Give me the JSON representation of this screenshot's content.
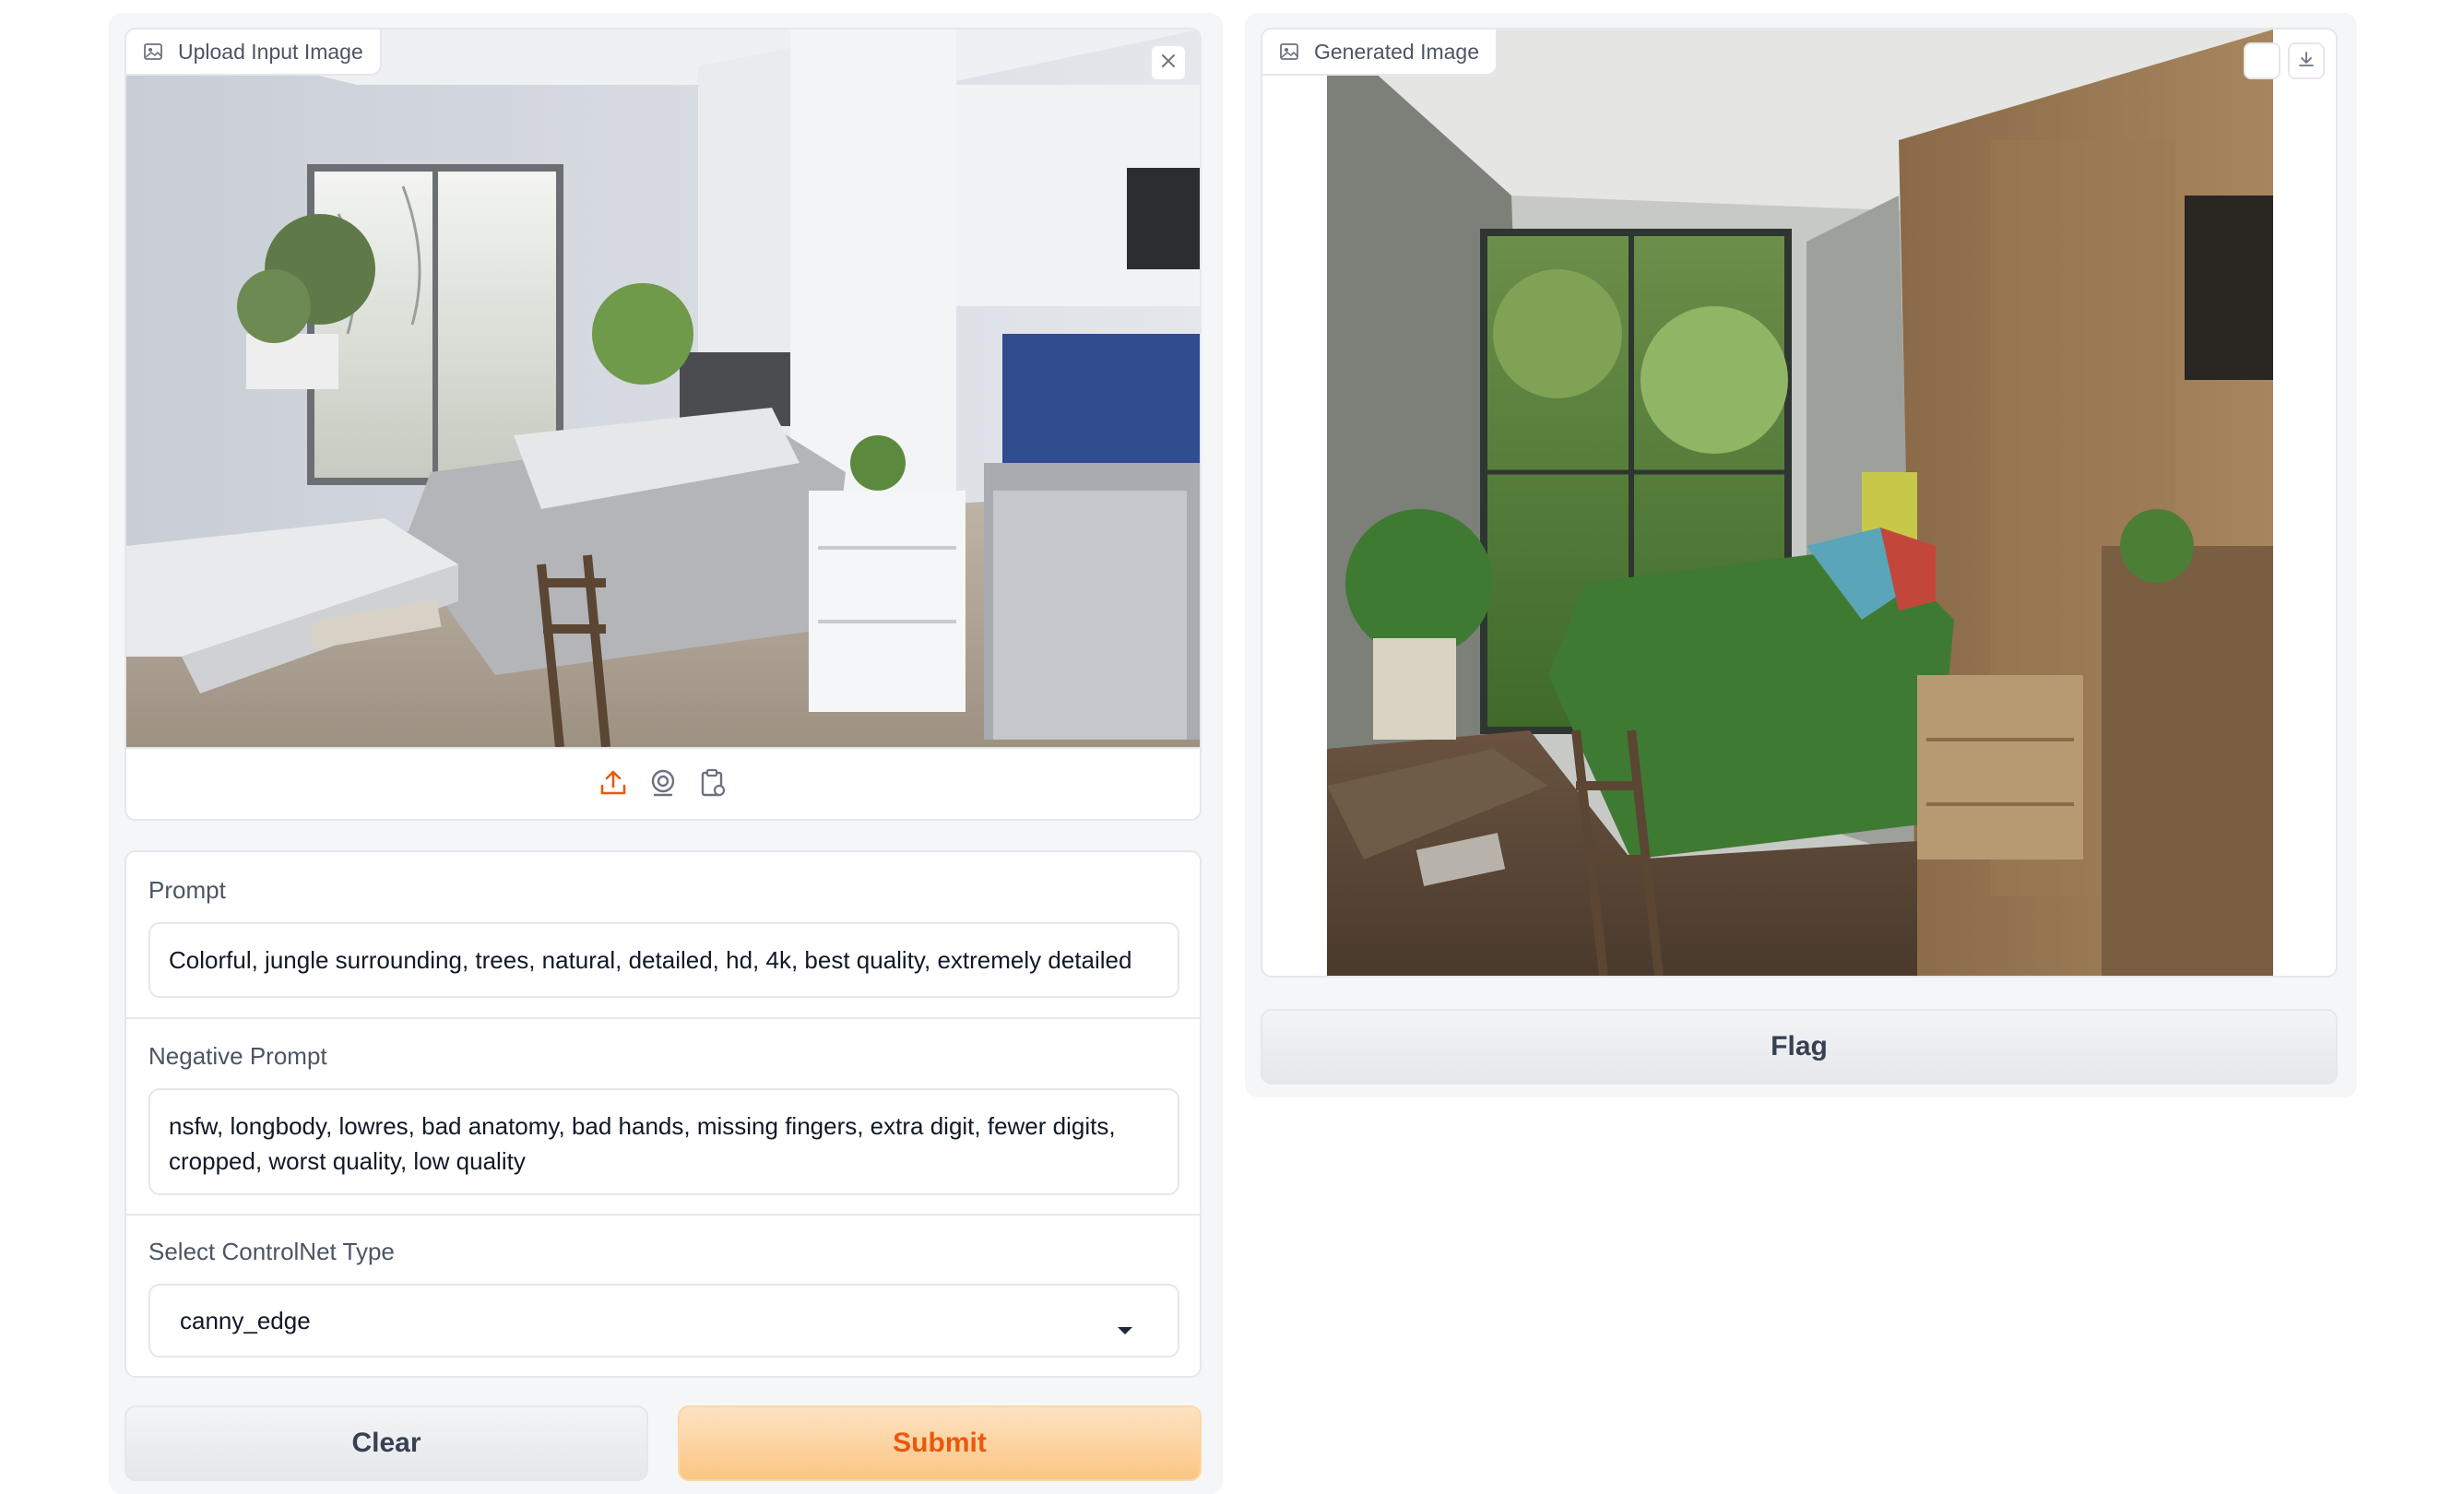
{
  "input_panel": {
    "image_label": "Upload Input Image",
    "icons": [
      "image-icon",
      "close-icon",
      "upload-icon",
      "webcam-icon",
      "clipboard-icon"
    ]
  },
  "form": {
    "prompt_label": "Prompt",
    "prompt_value": "Colorful, jungle surrounding, trees, natural, detailed, hd, 4k, best quality, extremely detailed",
    "negative_label": "Negative Prompt",
    "negative_value": "nsfw, longbody, lowres, bad anatomy, bad hands, missing fingers, extra digit, fewer digits, cropped, worst quality, low quality",
    "controlnet_label": "Select ControlNet Type",
    "controlnet_value": "canny_edge",
    "clear_label": "Clear",
    "submit_label": "Submit"
  },
  "output_panel": {
    "image_label": "Generated Image",
    "flag_label": "Flag",
    "icons": [
      "image-icon",
      "share-icon",
      "download-icon"
    ]
  },
  "colors": {
    "accent": "#ea580c",
    "submit_bg": "#fbc583",
    "panel_bg": "#f5f6f8",
    "border": "#e5e7eb"
  }
}
